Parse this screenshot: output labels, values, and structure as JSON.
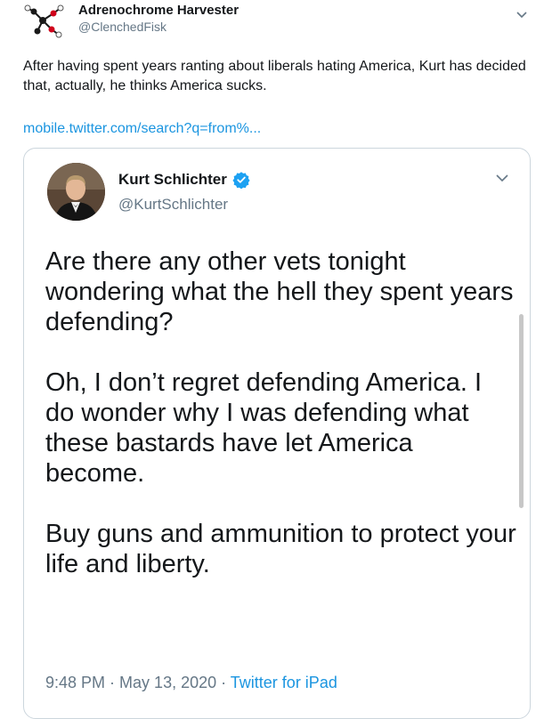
{
  "tweet": {
    "author_name": "Adrenochrome Harvester",
    "author_handle": "@ClenchedFisk",
    "text": "After having spent years ranting about liberals hating America, Kurt has decided that, actually, he thinks America sucks.",
    "link": "mobile.twitter.com/search?q=from%..."
  },
  "quoted_tweet": {
    "author_name": "Kurt Schlichter",
    "author_handle": "@KurtSchlichter",
    "paragraphs": [
      "Are there any other vets tonight wondering what the hell they spent years defending?",
      "Oh, I don’t regret defending America. I do wonder why I was defending what these bastards have let America become.",
      "Buy guns and ammunition to protect your life and liberty."
    ],
    "time": "9:48 PM",
    "sep1": " · ",
    "date": "May 13, 2020",
    "sep2": " · ",
    "source": "Twitter for iPad"
  },
  "colors": {
    "link": "#1b95e0",
    "secondary_text": "#657786",
    "border": "#ccd6dd",
    "verified": "#1da1f2"
  },
  "icons": {
    "avatar_top": "molecule-icon",
    "menu": "chevron-down-icon",
    "verified": "verified-badge-icon"
  }
}
